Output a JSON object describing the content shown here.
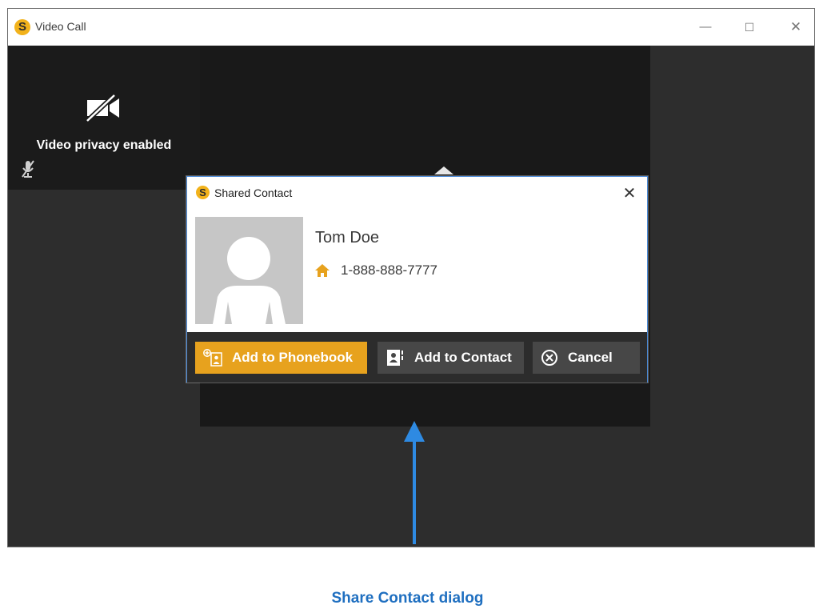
{
  "window": {
    "title": "Video Call",
    "logo_letter": "S",
    "minimize_glyph": "—",
    "maximize_glyph": "☐",
    "close_glyph": "✕"
  },
  "self_view": {
    "privacy_text": "Video privacy enabled",
    "camera_icon": "video-off-icon",
    "mic_icon": "mic-muted-icon"
  },
  "dialog": {
    "title": "Shared Contact",
    "logo_letter": "S",
    "close_glyph": "✕",
    "contact": {
      "name": "Tom Doe",
      "phone": "1-888-888-7777",
      "phone_icon": "home-icon"
    },
    "buttons": {
      "add_phonebook": "Add to Phonebook",
      "add_contact": "Add to Contact",
      "cancel": "Cancel"
    }
  },
  "annotation": {
    "caption": "Share Contact dialog"
  },
  "colors": {
    "accent": "#e7a21e",
    "annotation_blue": "#2e8ae2",
    "dialog_border": "#4a8ad8",
    "footer_bg": "#2c2c2c"
  }
}
